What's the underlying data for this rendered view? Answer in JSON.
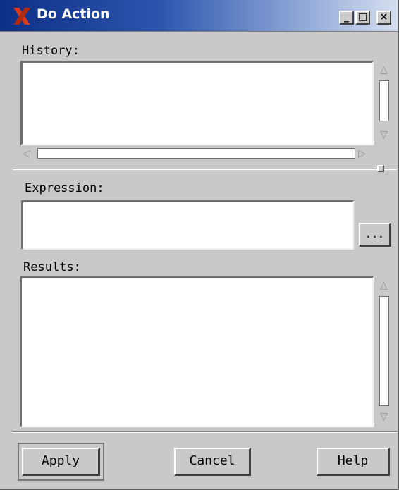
{
  "window": {
    "title": "Do Action",
    "controls": {
      "minimize": "_",
      "maximize": "□",
      "close": "×"
    }
  },
  "history": {
    "label": "History:",
    "value": ""
  },
  "expression": {
    "label": "Expression:",
    "value": "",
    "browse_label": "..."
  },
  "results": {
    "label": "Results:",
    "value": ""
  },
  "buttons": {
    "apply": "Apply",
    "cancel": "Cancel",
    "help": "Help"
  },
  "icons": [
    "x-app-logo-icon",
    "minimize-icon",
    "maximize-icon",
    "close-icon",
    "arrow-up-icon",
    "arrow-down-icon",
    "arrow-left-icon",
    "arrow-right-icon"
  ],
  "colors": {
    "titlebar_start": "#0d2f86",
    "titlebar_end": "#d7dff0",
    "window_bg": "#c9c9c9",
    "field_bg": "#ffffff"
  }
}
